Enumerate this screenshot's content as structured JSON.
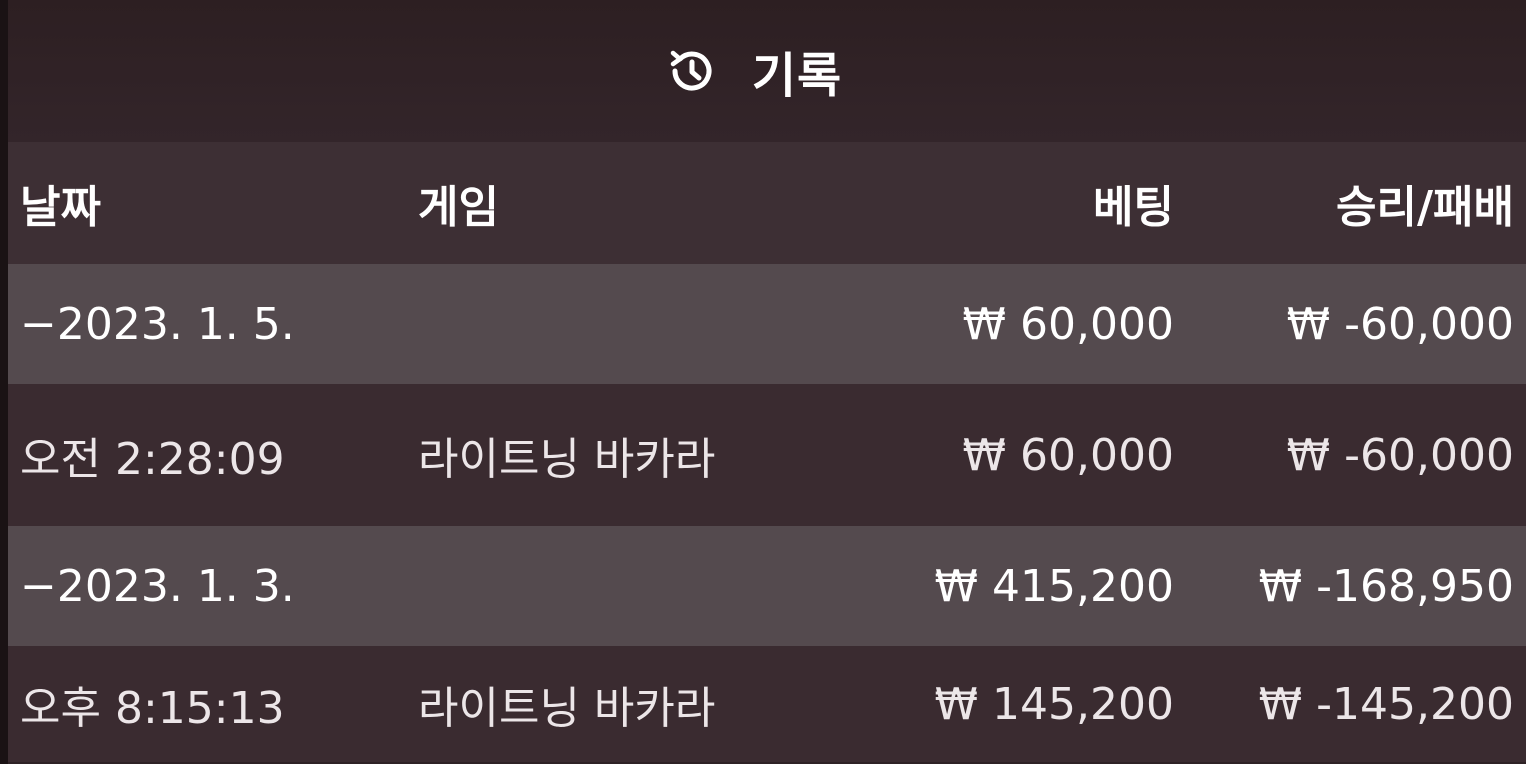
{
  "header": {
    "icon": "history-icon",
    "title": "기록"
  },
  "table": {
    "columns": [
      "날짜",
      "게임",
      "베팅",
      "승리/패배"
    ],
    "rows": [
      {
        "type": "date",
        "date": "−2023. 1. 5.",
        "game": "",
        "bet": "₩ 60,000",
        "result": "₩ -60,000"
      },
      {
        "type": "entry",
        "date": "오전 2:28:09",
        "game": "라이트닝 바카라",
        "bet": "₩ 60,000",
        "result": "₩ -60,000"
      },
      {
        "type": "date",
        "date": "−2023. 1. 3.",
        "game": "",
        "bet": "₩ 415,200",
        "result": "₩ -168,950"
      },
      {
        "type": "entry",
        "date": "오후 8:15:13",
        "game": "라이트닝 바카라",
        "bet": "₩ 145,200",
        "result": "₩ -145,200"
      }
    ]
  },
  "colors": {
    "background": "#2e2225",
    "header_row": "#3d2f34",
    "date_row": "#544a4e",
    "entry_row": "#3a2b30",
    "text": "#ffffff"
  }
}
